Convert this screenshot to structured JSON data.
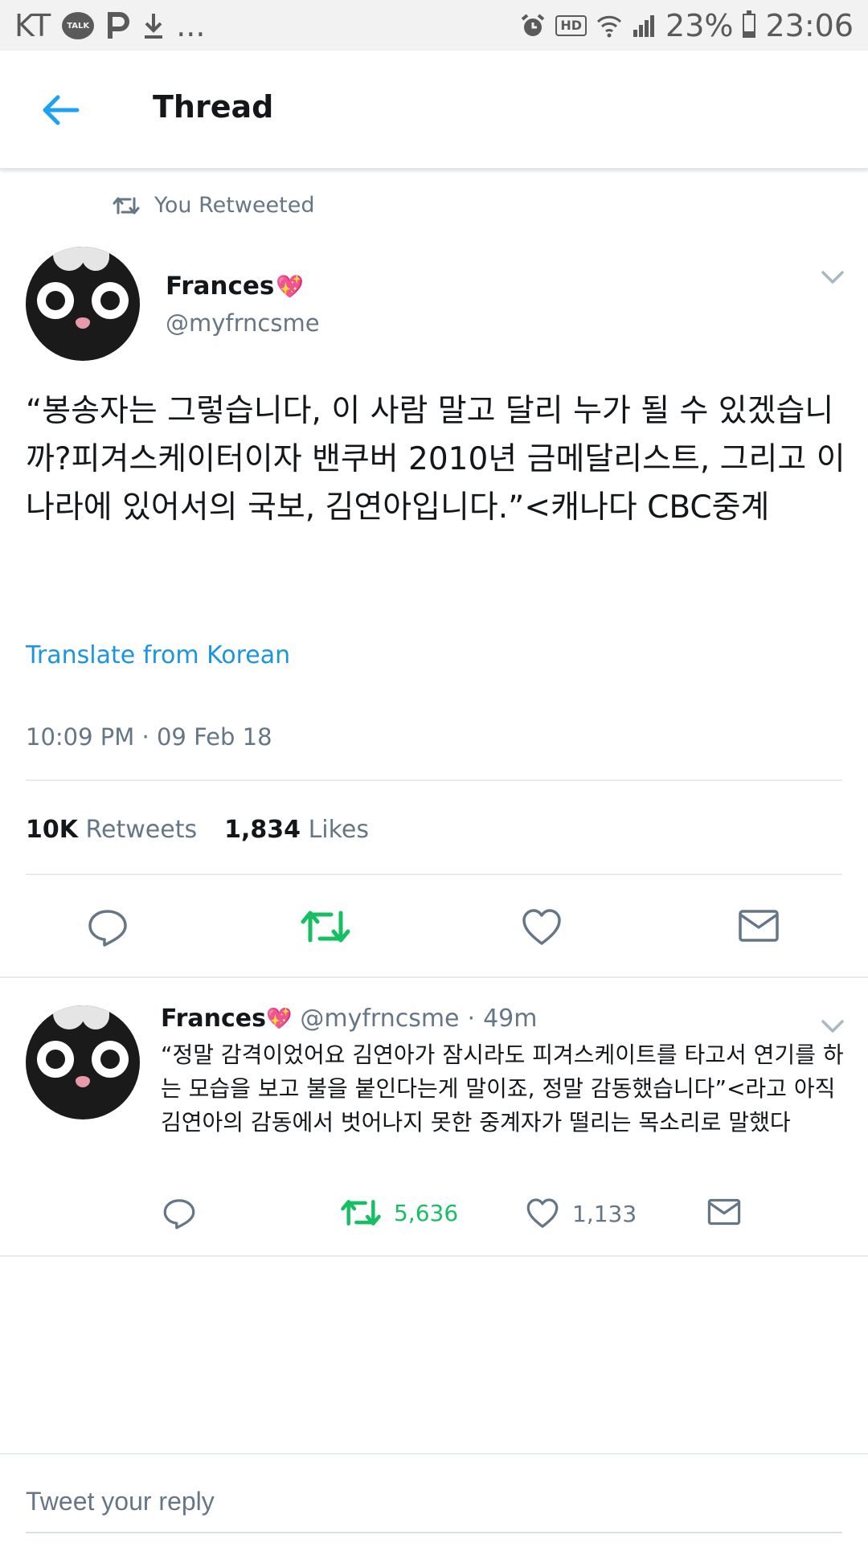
{
  "status_bar": {
    "carrier": "KT",
    "talk_label": "TALK",
    "more": "...",
    "hd_label": "HD",
    "battery_percent": "23%",
    "battery_level": 0.23,
    "time": "23:06",
    "icons_left": [
      "kakaotalk-icon",
      "parking-icon",
      "download-icon"
    ],
    "icons_right": [
      "alarm-icon",
      "hd-icon",
      "wifi-icon",
      "signal-icon",
      "battery-icon"
    ]
  },
  "header": {
    "title": "Thread",
    "back_icon": "arrow-left-icon"
  },
  "retweet_context": {
    "label": "You Retweeted",
    "icon": "retweet-icon"
  },
  "main_tweet": {
    "name": "Frances",
    "name_emoji": "💖",
    "handle": "@myfrncsme",
    "text": "“봉송자는 그렇습니다, 이 사람 말고 달리 누가 될 수 있겠습니까?피겨스케이터이자 밴쿠버 2010년 금메달리스트, 그리고 이 나라에 있어서의 국보, 김연아입니다.”<캐나다 CBC중계",
    "translate_label": "Translate from Korean",
    "timestamp": "10:09 PM · 09 Feb 18",
    "retweets_count": "10K",
    "retweets_label": "Retweets",
    "likes_count": "1,834",
    "likes_label": "Likes",
    "colors": {
      "retweet_active": "#17bf63",
      "link": "#1b95e0",
      "muted": "#657786"
    }
  },
  "reply_tweet": {
    "name": "Frances",
    "name_emoji": "💖",
    "handle": "@myfrncsme",
    "separator": "·",
    "age": "49m",
    "text": "“정말 감격이었어요 김연아가 잠시라도 피겨스케이트를 타고서 연기를 하는 모습을 보고 불을 붙인다는게 말이죠, 정말 감동했습니다”<라고 아직 김연아의 감동에서 벗어나지 못한 중계자가 떨리는 목소리로 말했다",
    "retweet_count": "5,636",
    "like_count": "1,133"
  },
  "reply_box": {
    "placeholder": "Tweet your reply"
  }
}
